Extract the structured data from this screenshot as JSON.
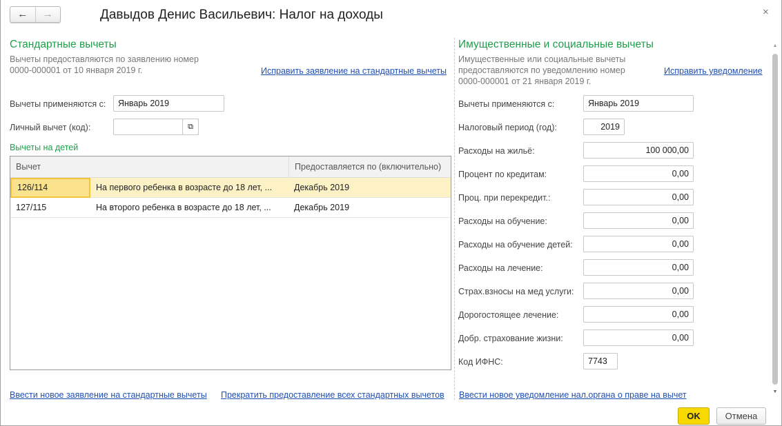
{
  "window": {
    "title": "Давыдов Денис Васильевич: Налог на доходы",
    "back_icon": "arrow-left-icon",
    "forward_icon": "arrow-right-icon",
    "close_icon": "×"
  },
  "standard": {
    "heading": "Стандартные вычеты",
    "note_line1": "Вычеты предоставляются по заявлению номер",
    "note_line2": "0000-000001 от 10 января 2019 г.",
    "fix_link": "Исправить заявление на стандартные вычеты",
    "applies_from_label": "Вычеты применяются с:",
    "applies_from_value": "Январь 2019",
    "personal_label": "Личный вычет (код):",
    "personal_value": "",
    "children_heading": "Вычеты на детей",
    "table": {
      "columns": [
        "Вычет",
        "Предоставляется по (включительно)"
      ],
      "rows": [
        {
          "code": "126/114",
          "desc": "На первого ребенка в возрасте до 18 лет, ...",
          "until": "Декабрь 2019",
          "selected": true
        },
        {
          "code": "127/115",
          "desc": "На второго ребенка в возрасте до 18 лет, ...",
          "until": "Декабрь 2019",
          "selected": false
        }
      ]
    },
    "new_link": "Ввести новое заявление на стандартные вычеты",
    "stop_link": "Прекратить предоставление всех стандартных вычетов"
  },
  "property": {
    "heading": "Имущественные и социальные вычеты",
    "note_line1": "Имущественные или социальные вычеты",
    "note_line2": "предоставляются по уведомлению номер",
    "note_line3": "0000-000001 от 21 января 2019 г.",
    "fix_link": "Исправить уведомление",
    "fields": [
      {
        "label": "Вычеты применяются с:",
        "value": "Январь 2019"
      },
      {
        "label": "Налоговый период (год):",
        "value": "2019"
      },
      {
        "label": "Расходы на жильё:",
        "value": "100 000,00"
      },
      {
        "label": "Процент по кредитам:",
        "value": "0,00"
      },
      {
        "label": "Проц. при перекредит.:",
        "value": "0,00"
      },
      {
        "label": "Расходы на обучение:",
        "value": "0,00"
      },
      {
        "label": "Расходы на обучение детей:",
        "value": "0,00"
      },
      {
        "label": "Расходы на лечение:",
        "value": "0,00"
      },
      {
        "label": "Страх.взносы на мед услуги:",
        "value": "0,00"
      },
      {
        "label": "Дорогостоящее лечение:",
        "value": "0,00"
      },
      {
        "label": "Добр. страхование жизни:",
        "value": "0,00"
      },
      {
        "label": "Код ИФНС:",
        "value": "7743"
      }
    ],
    "new_link": "Ввести новое уведомление нал.органа о праве на вычет"
  },
  "footer": {
    "ok": "OK",
    "cancel": "Отмена"
  }
}
